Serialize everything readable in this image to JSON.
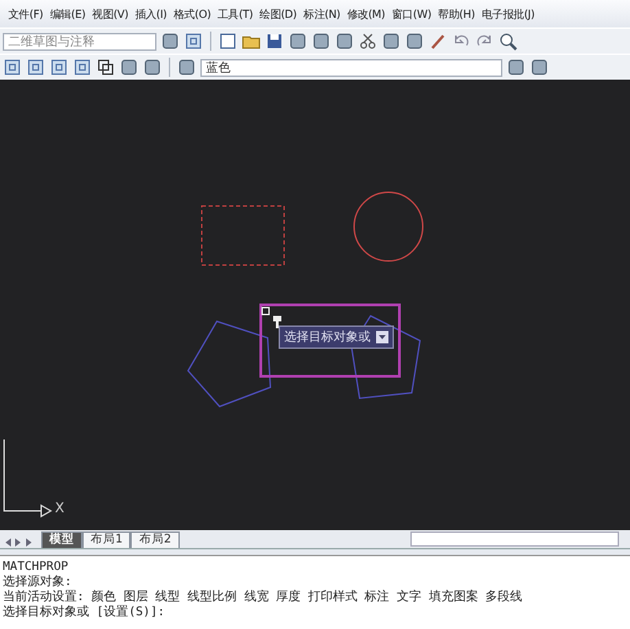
{
  "menu_bar": {
    "items": [
      "文件(F)",
      "编辑(E)",
      "视图(V)",
      "插入(I)",
      "格式(O)",
      "工具(T)",
      "绘图(D)",
      "标注(N)",
      "修改(M)",
      "窗口(W)",
      "帮助(H)",
      "电子报批(J)"
    ]
  },
  "toolbar": {
    "workspace": "二维草图与注释",
    "layer": "蓝色"
  },
  "canvas": {
    "tooltip": "选择目标对象或",
    "axis_label": "X"
  },
  "tabs": [
    {
      "label": "模型",
      "selected": true
    },
    {
      "label": "布局1",
      "selected": false
    },
    {
      "label": "布局2",
      "selected": false
    }
  ],
  "command_lines": [
    "MATCHPROP",
    "选择源对象:",
    "当前活动设置:  颜色 图层 线型 线型比例 线宽 厚度 打印样式 标注 文字 填充图案 多段线",
    "选择目标对象或 [设置(S)]:"
  ]
}
